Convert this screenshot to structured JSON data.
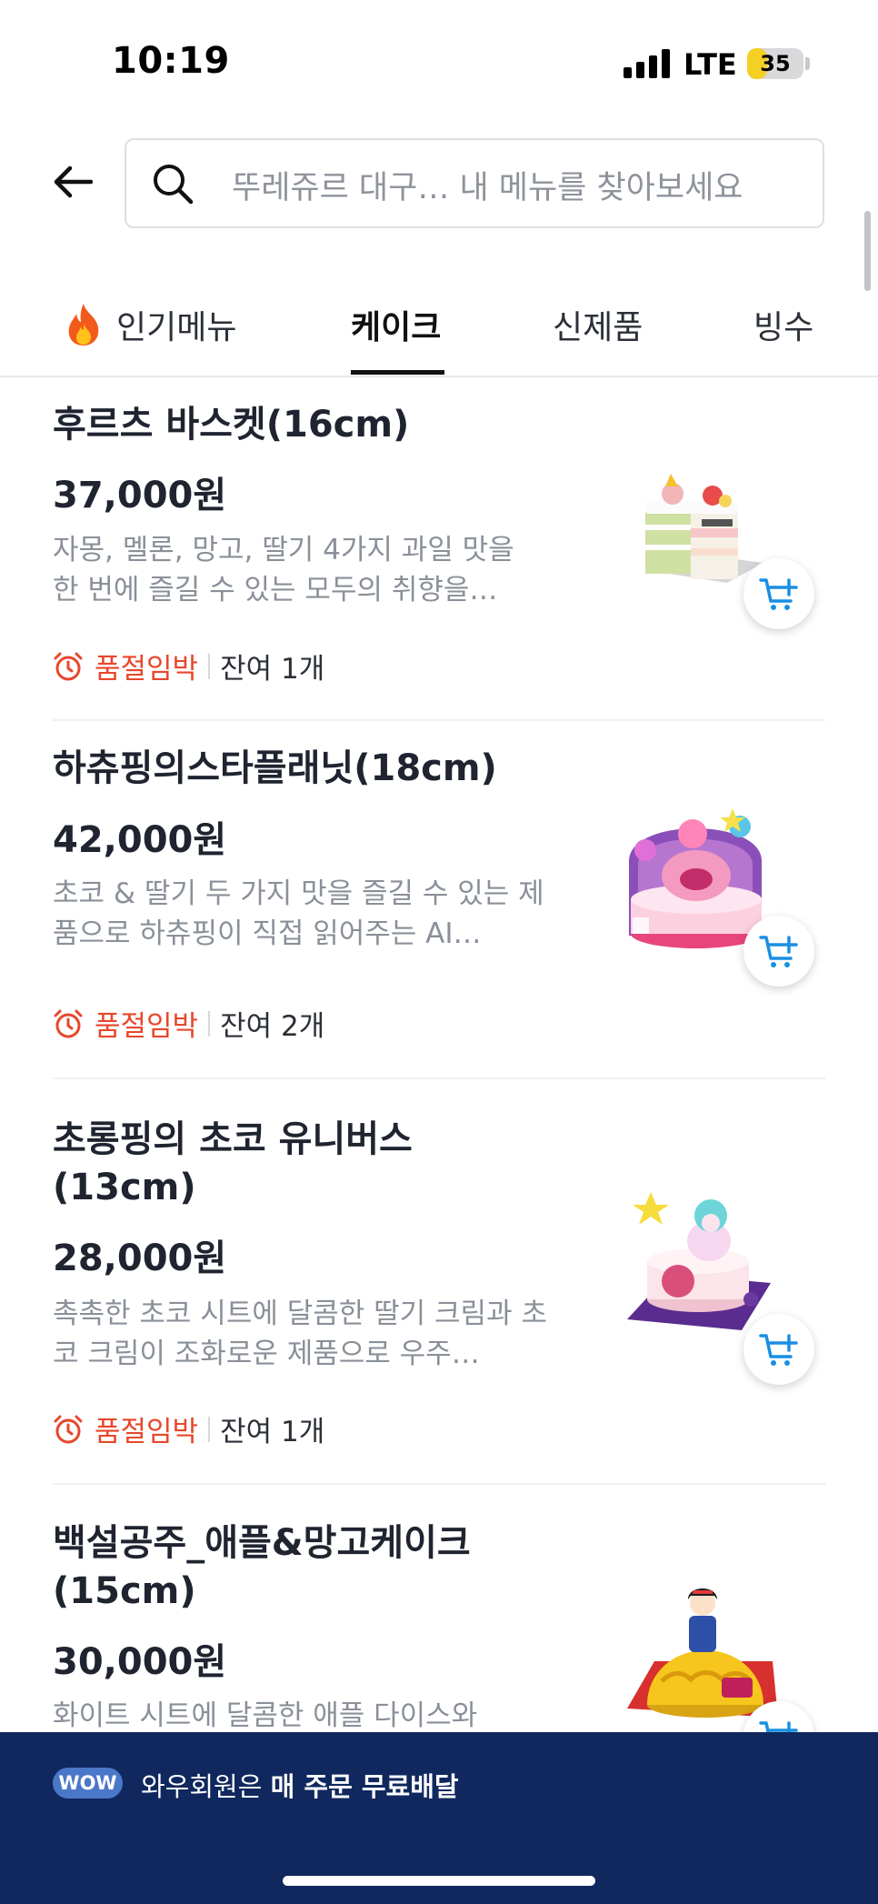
{
  "status_bar": {
    "time": "10:19",
    "network": "LTE",
    "battery": "35",
    "battery_level": 0.35
  },
  "search": {
    "placeholder": "뚜레쥬르 대구… 내 메뉴를 찾아보세요"
  },
  "tabs": [
    {
      "label": "인기메뉴",
      "icon": "fire-icon",
      "active": false
    },
    {
      "label": "케이크",
      "active": true
    },
    {
      "label": "신제품",
      "active": false
    },
    {
      "label": "빙수",
      "active": false
    }
  ],
  "products": [
    {
      "name": "후르츠 바스켓(16cm)",
      "price": "37,000원",
      "description": "자몽, 멜론, 망고, 딸기 4가지 과일 맛을 한 번에 즐길 수 있는 모두의 취향을…",
      "badge": "품절임박",
      "stock": "잔여 1개"
    },
    {
      "name": "하츄핑의스타플래닛(18cm)",
      "price": "42,000원",
      "description": "초코 & 딸기 두 가지 맛을 즐길 수 있는 제품으로 하츄핑이 직접 읽어주는 AI…",
      "badge": "품절임박",
      "stock": "잔여 2개"
    },
    {
      "name": "초롱핑의 초코 유니버스 (13cm)",
      "price": "28,000원",
      "description": "촉촉한 초코 시트에 달콤한 딸기 크림과 초코 크림이 조화로운 제품으로 우주…",
      "badge": "품절임박",
      "stock": "잔여 1개"
    },
    {
      "name": "백설공주_애플&망고케이크 (15cm)",
      "price": "30,000원",
      "description": "화이트 시트에 달콤한 애플 다이스와"
    }
  ],
  "banner": {
    "badge": "WOW",
    "text_prefix": "와우회원은 ",
    "text_bold": "매 주문 무료배달"
  },
  "colors": {
    "accent_blue": "#1a8fe3",
    "soldout_red": "#e8472b",
    "banner_navy": "#10285e"
  }
}
